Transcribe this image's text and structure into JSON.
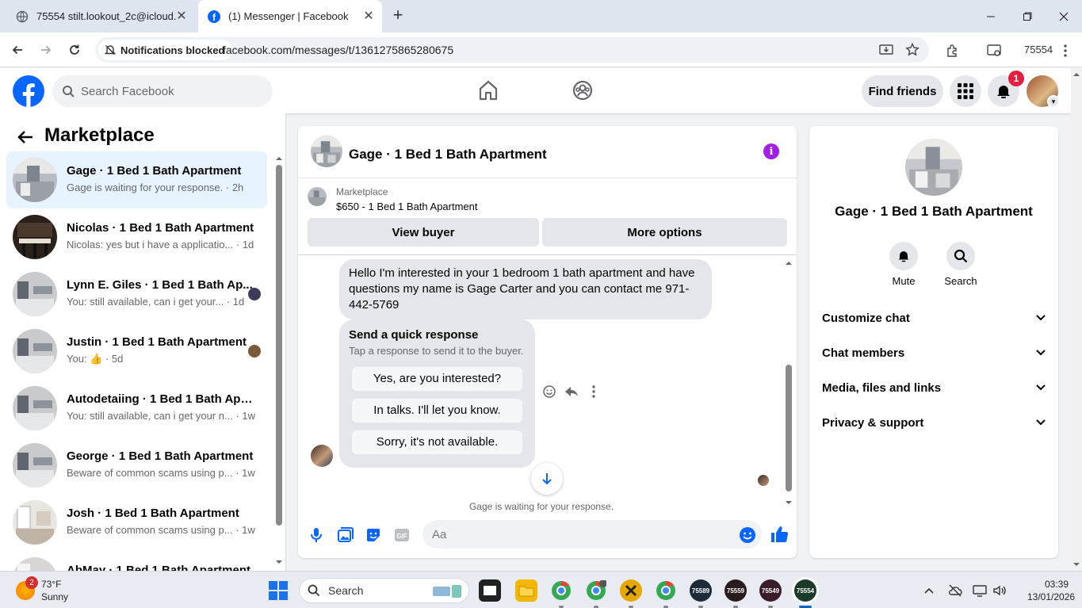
{
  "browser": {
    "tabs": [
      {
        "title": "75554 stilt.lookout_2c@icloud.c",
        "active": false
      },
      {
        "title": "(1) Messenger | Facebook",
        "active": true
      }
    ],
    "notification_chip": "Notifications blocked",
    "url": "facebook.com/messages/t/1361275865280675",
    "profile_label": "75554"
  },
  "fb_header": {
    "search_placeholder": "Search Facebook",
    "find_friends": "Find friends",
    "notification_count": "1"
  },
  "sidebar": {
    "title": "Marketplace",
    "conversations": [
      {
        "name": "Gage · 1 Bed 1 Bath Apartment",
        "message": "Gage is waiting for your response. · 2h",
        "active": true
      },
      {
        "name": "Nicolas · 1 Bed 1 Bath Apartment",
        "message": "Nicolas: yes but i have a applicatio... · 1d",
        "active": false
      },
      {
        "name": "Lynn E. Giles · 1 Bed 1 Bath Ap...",
        "message": "You: still available, can i get your... · 1d",
        "active": false
      },
      {
        "name": "Justin · 1 Bed 1 Bath Apartment",
        "message": "You: 👍 · 5d",
        "active": false
      },
      {
        "name": "Autodetaiing · 1 Bed 1 Bath Apar...",
        "message": "You: still available, can i get your n... · 1w",
        "active": false
      },
      {
        "name": "George · 1 Bed 1 Bath Apartment",
        "message": "Beware of common scams using p... · 1w",
        "active": false
      },
      {
        "name": "Josh · 1 Bed 1 Bath Apartment",
        "message": "Beware of common scams using p... · 1w",
        "active": false
      },
      {
        "name": "AbMay · 1 Bed 1 Bath Apartment",
        "message": "",
        "active": false
      }
    ]
  },
  "chat": {
    "title": "Gage · 1 Bed 1 Bath Apartment",
    "marketplace_label": "Marketplace",
    "listing": "$650 - 1 Bed 1 Bath Apartment",
    "view_buyer": "View buyer",
    "more_options": "More options",
    "message": "Hello I'm interested in your 1 bedroom 1 bath apartment and have questions my name is Gage Carter and you can contact me 971-442-5769",
    "quick_response_title": "Send a quick response",
    "quick_response_sub": "Tap a response to send it to the buyer.",
    "quick_responses": [
      "Yes, are you interested?",
      "In talks. I'll let you know.",
      "Sorry, it's not available."
    ],
    "waiting_text": "Gage is waiting for your response.",
    "input_placeholder": "Aa"
  },
  "info_panel": {
    "name": "Gage · 1 Bed 1 Bath Apartment",
    "mute": "Mute",
    "search": "Search",
    "sections": [
      "Customize chat",
      "Chat members",
      "Media, files and links",
      "Privacy & support"
    ]
  },
  "taskbar": {
    "weather_badge": "2",
    "temperature": "73°F",
    "condition": "Sunny",
    "search_label": "Search",
    "apps": [
      "75589",
      "75559",
      "75549",
      "75554"
    ],
    "time": "03:39",
    "date": "13/01/2026"
  },
  "colors": {
    "fb_blue": "#0866ff",
    "active_conv": "#e7f3ff",
    "info_purple": "#a31ee6",
    "badge_red": "#e41e3f"
  }
}
